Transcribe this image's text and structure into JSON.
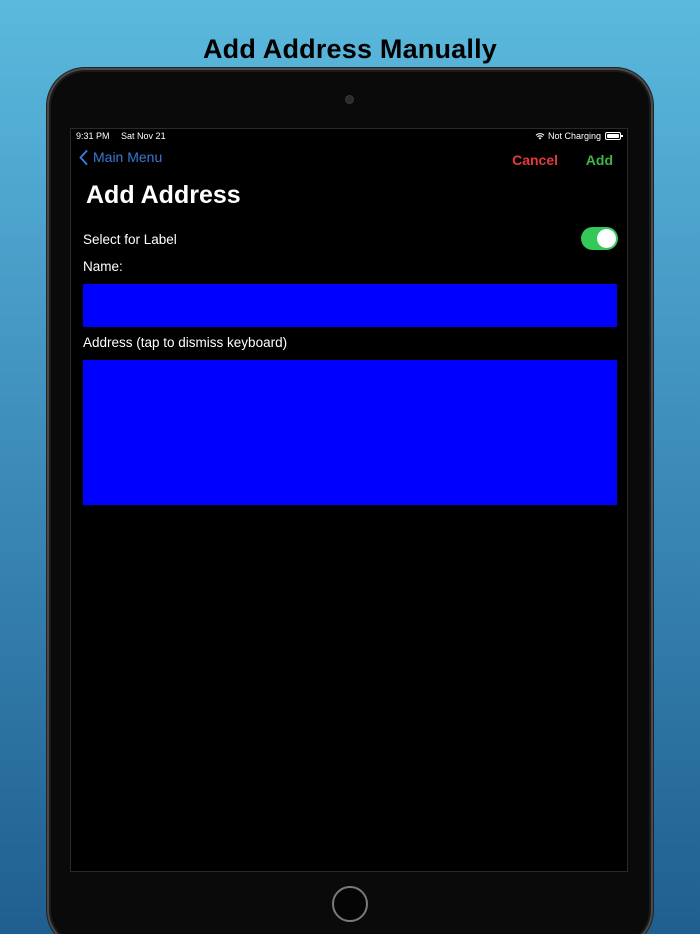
{
  "promo": {
    "title": "Add Address Manually"
  },
  "status_bar": {
    "time": "9:31 PM",
    "date": "Sat Nov 21",
    "charging": "Not Charging",
    "icons": [
      "wifi-icon",
      "battery-icon"
    ]
  },
  "nav": {
    "back_label": "Main Menu",
    "back_icon": "chevron-left-icon",
    "cancel_label": "Cancel",
    "add_label": "Add"
  },
  "form": {
    "title": "Add Address",
    "toggle_label": "Select for Label",
    "toggle_on": true,
    "name_label": "Name:",
    "name_value": "",
    "address_label": "Address (tap to dismiss keyboard)",
    "address_value": ""
  },
  "colors": {
    "back": "#3a78d8",
    "cancel": "#e23b3b",
    "add": "#3cb54a",
    "toggle_on": "#34c759",
    "field_bg": "#0000ff"
  }
}
